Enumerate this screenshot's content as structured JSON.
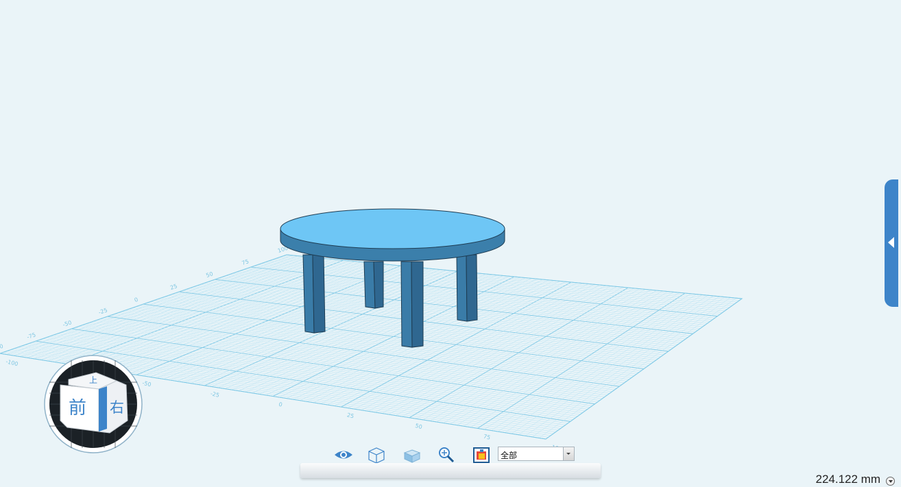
{
  "viewcube": {
    "top_label": "上",
    "front_label": "前",
    "right_label": "右"
  },
  "grid": {
    "left_ticks": [
      "100",
      "75",
      "50",
      "25",
      "0",
      "-25",
      "-50",
      "-75",
      "-100"
    ],
    "front_ticks": [
      "-100",
      "-75",
      "-50",
      "-25",
      "0",
      "25",
      "50",
      "75",
      "100"
    ]
  },
  "toolbar": {
    "buttons": [
      {
        "icon": "eye-icon"
      },
      {
        "icon": "wireframe-cube-icon"
      },
      {
        "icon": "solid-cube-icon"
      },
      {
        "icon": "zoom-icon"
      },
      {
        "icon": "screenshot-icon"
      }
    ],
    "filter_select": {
      "value": "全部"
    }
  },
  "measurement": {
    "value": "224.122 mm"
  },
  "colors": {
    "background": "#eaf4f8",
    "grid_line": "#9bd6ee",
    "model_top": "#6ec6f5",
    "model_side": "#3b7fab",
    "accent": "#3d84c9"
  }
}
